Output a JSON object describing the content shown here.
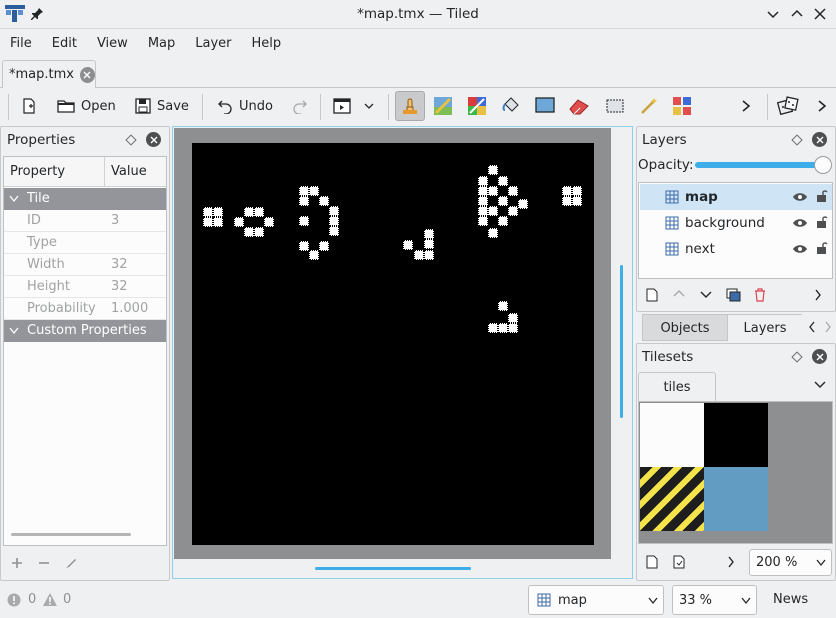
{
  "window": {
    "title": "*map.tmx — Tiled"
  },
  "menu": [
    "File",
    "Edit",
    "View",
    "Map",
    "Layer",
    "Help"
  ],
  "doc_tab": {
    "label": "*map.tmx"
  },
  "toolbar": {
    "open_label": "Open",
    "save_label": "Save",
    "undo_label": "Undo"
  },
  "properties": {
    "title": "Properties",
    "columns": [
      "Property",
      "Value"
    ],
    "group_tile": "Tile",
    "rows": [
      {
        "name": "ID",
        "value": "3"
      },
      {
        "name": "Type",
        "value": ""
      },
      {
        "name": "Width",
        "value": "32"
      },
      {
        "name": "Height",
        "value": "32"
      },
      {
        "name": "Probability",
        "value": "1.000"
      }
    ],
    "group_custom": "Custom Properties"
  },
  "layers": {
    "title": "Layers",
    "opacity_label": "Opacity:",
    "opacity": 1.0,
    "items": [
      "map",
      "background",
      "next"
    ],
    "selected": "map"
  },
  "dock_tabs": {
    "objects": "Objects",
    "layers": "Layers"
  },
  "tilesets": {
    "title": "Tilesets",
    "tab": "tiles",
    "zoom": "200 %"
  },
  "statusbar": {
    "errors": "0",
    "warnings": "0",
    "layer": "map",
    "zoom": "33 %",
    "news": "News"
  },
  "colors": {
    "accent": "#3daee9",
    "selection": "#cfe5f6",
    "tile_blue": "#629cc3",
    "tile_yellow": "#f4e34b"
  }
}
